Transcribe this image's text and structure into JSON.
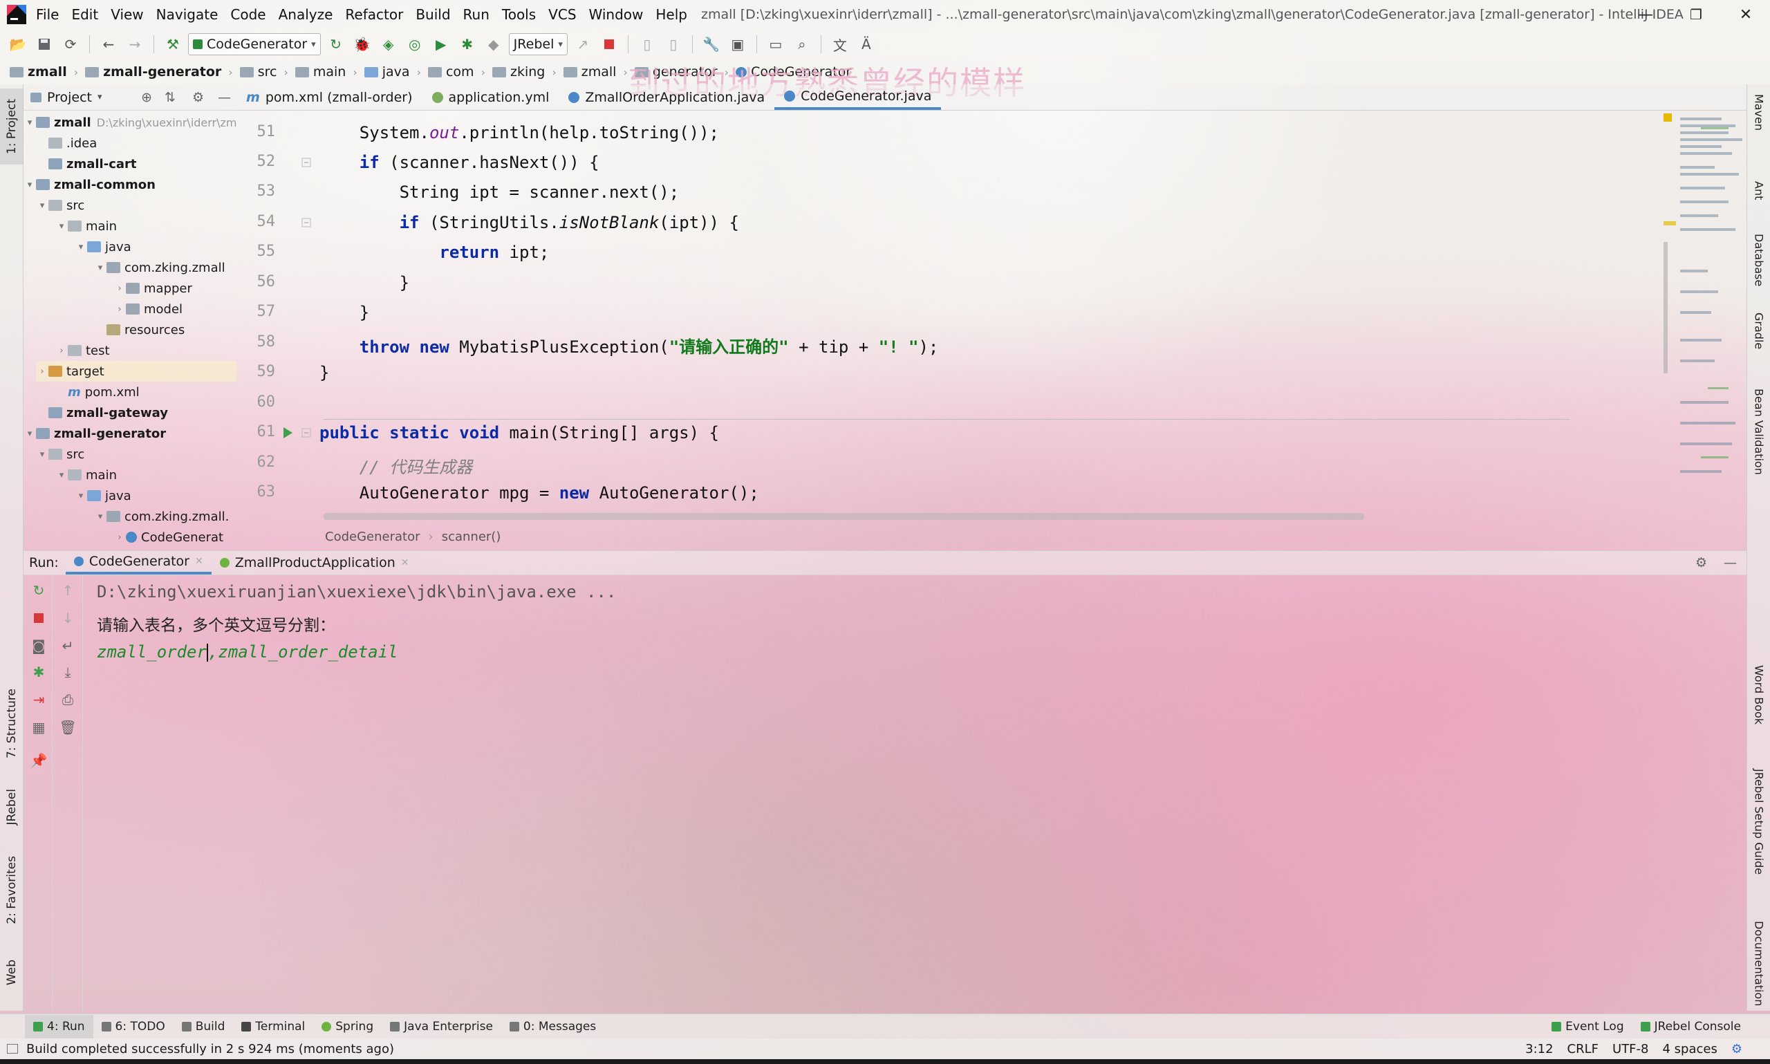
{
  "window": {
    "title": "zmall [D:\\zking\\xuexinr\\iderr\\zmall] - ...\\zmall-generator\\src\\main\\java\\com\\zking\\zmall\\generator\\CodeGenerator.java [zmall-generator] - IntelliJ IDEA",
    "minimize": "—",
    "restore": "❐",
    "close": "✕"
  },
  "menu": [
    "File",
    "Edit",
    "View",
    "Navigate",
    "Code",
    "Analyze",
    "Refactor",
    "Build",
    "Run",
    "Tools",
    "VCS",
    "Window",
    "Help"
  ],
  "toolbar": {
    "run_config": "CodeGenerator",
    "jrebel_combo": "JRebel"
  },
  "breadcrumb": [
    "zmall",
    "zmall-generator",
    "src",
    "main",
    "java",
    "com",
    "zking",
    "zmall",
    "generator",
    "CodeGenerator"
  ],
  "overlay_text": "到过的地方熟悉曾经的模样",
  "project_panel": {
    "title": "Project",
    "tree": [
      {
        "label": "zmall",
        "extra": "D:\\zking\\xuexinr\\iderr\\zmall",
        "icon": "module-icon",
        "bold": true
      },
      {
        "label": ".idea",
        "icon": "folder-icon"
      },
      {
        "label": "zmall-cart",
        "icon": "module-icon",
        "bold": true
      },
      {
        "label": "zmall-common",
        "icon": "module-icon",
        "bold": true
      },
      {
        "label": "src",
        "icon": "folder-icon"
      },
      {
        "label": "main",
        "icon": "folder-icon"
      },
      {
        "label": "java",
        "icon": "source-folder-icon"
      },
      {
        "label": "com.zking.zmall",
        "icon": "package-icon"
      },
      {
        "label": "mapper",
        "icon": "package-icon"
      },
      {
        "label": "model",
        "icon": "package-icon"
      },
      {
        "label": "resources",
        "icon": "resources-folder-icon"
      },
      {
        "label": "test",
        "icon": "folder-icon"
      },
      {
        "label": "target",
        "icon": "target-folder-icon"
      },
      {
        "label": "pom.xml",
        "icon": "maven-icon"
      },
      {
        "label": "zmall-gateway",
        "icon": "module-icon",
        "bold": true
      },
      {
        "label": "zmall-generator",
        "icon": "module-icon",
        "bold": true
      },
      {
        "label": "src",
        "icon": "folder-icon"
      },
      {
        "label": "main",
        "icon": "folder-icon"
      },
      {
        "label": "java",
        "icon": "source-folder-icon"
      },
      {
        "label": "com.zking.zmall.",
        "icon": "package-icon"
      },
      {
        "label": "CodeGenerat",
        "icon": "class-icon"
      }
    ]
  },
  "editor_tabs": [
    {
      "label": "pom.xml (zmall-order)",
      "icon": "maven-icon"
    },
    {
      "label": "application.yml",
      "icon": "yaml-icon"
    },
    {
      "label": "ZmallOrderApplication.java",
      "icon": "class-icon"
    },
    {
      "label": "CodeGenerator.java",
      "icon": "class-icon",
      "active": true
    }
  ],
  "code": {
    "line_numbers": [
      "51",
      "52",
      "53",
      "54",
      "55",
      "56",
      "57",
      "58",
      "59",
      "60",
      "61",
      "62",
      "63"
    ],
    "lines": [
      "    System.out.println(help.toString());",
      "    if (scanner.hasNext()) {",
      "        String ipt = scanner.next();",
      "        if (StringUtils.isNotBlank(ipt)) {",
      "            return ipt;",
      "        }",
      "    }",
      "    throw new MybatisPlusException(\"请输入正确的\" + tip + \"! \");",
      "}",
      "",
      "public static void main(String[] args) {",
      "    // 代码生成器",
      "    AutoGenerator mpg = new AutoGenerator();"
    ],
    "parts": {
      "l51a": "    System.",
      "l51b": "out",
      "l51c": ".println(help.toString());",
      "l52a": "    ",
      "l52b": "if",
      "l52c": " (scanner.hasNext()) {",
      "l53": "        String ipt = scanner.next();",
      "l54a": "        ",
      "l54b": "if",
      "l54c": " (StringUtils.",
      "l54d": "isNotBlank",
      "l54e": "(ipt)) {",
      "l55a": "            ",
      "l55b": "return",
      "l55c": " ipt;",
      "l56": "        }",
      "l57": "    }",
      "l58a": "    ",
      "l58b": "throw new",
      "l58c": " MybatisPlusException(",
      "l58d": "\"请输入正确的\"",
      "l58e": " + tip + ",
      "l58f": "\"! \"",
      "l58g": ");",
      "l59": "}",
      "l61a": "public static void",
      "l61b": " main(String[] args) {",
      "l62a": "    ",
      "l62b": "// 代码生成器",
      "l63a": "    AutoGenerator mpg = ",
      "l63b": "new",
      "l63c": " AutoGenerator();"
    }
  },
  "editor_breadcrumb": [
    "CodeGenerator",
    "scanner()"
  ],
  "run_panel": {
    "label": "Run:",
    "tabs": [
      "CodeGenerator",
      "ZmallProductApplication"
    ],
    "console": {
      "command": "D:\\zking\\xuexiruanjian\\xuexiexe\\jdk\\bin\\java.exe ...",
      "prompt": "请输入表名，多个英文逗号分割：",
      "input_before_caret": "zmall_order",
      "input_after_caret": ",zmall_order_detail"
    }
  },
  "left_tabs": [
    "1: Project",
    "7: Structure",
    "JRebel",
    "2: Favorites",
    "Web"
  ],
  "right_tabs": [
    "Maven",
    "Ant",
    "Database",
    "Gradle",
    "Bean Validation",
    "Word Book",
    "JRebel Setup Guide",
    "Documentation"
  ],
  "bottom_tools": [
    {
      "label": "4: Run",
      "active": true
    },
    {
      "label": "6: TODO"
    },
    {
      "label": "Build"
    },
    {
      "label": "Terminal"
    },
    {
      "label": "Spring"
    },
    {
      "label": "Java Enterprise"
    },
    {
      "label": "0: Messages"
    }
  ],
  "bottom_right_tools": [
    "Event Log",
    "JRebel Console"
  ],
  "status": {
    "message": "Build completed successfully in 2 s 924 ms (moments ago)",
    "position": "3:12",
    "line_sep": "CRLF",
    "encoding": "UTF-8",
    "indent": "4 spaces"
  },
  "colors": {
    "keyword": "#0b2aa6",
    "string": "#117a1b",
    "field": "#7a1d93",
    "comment": "#7f7f7f",
    "console_input": "#1b8a2a",
    "tab_accent": "#4a88c7"
  }
}
